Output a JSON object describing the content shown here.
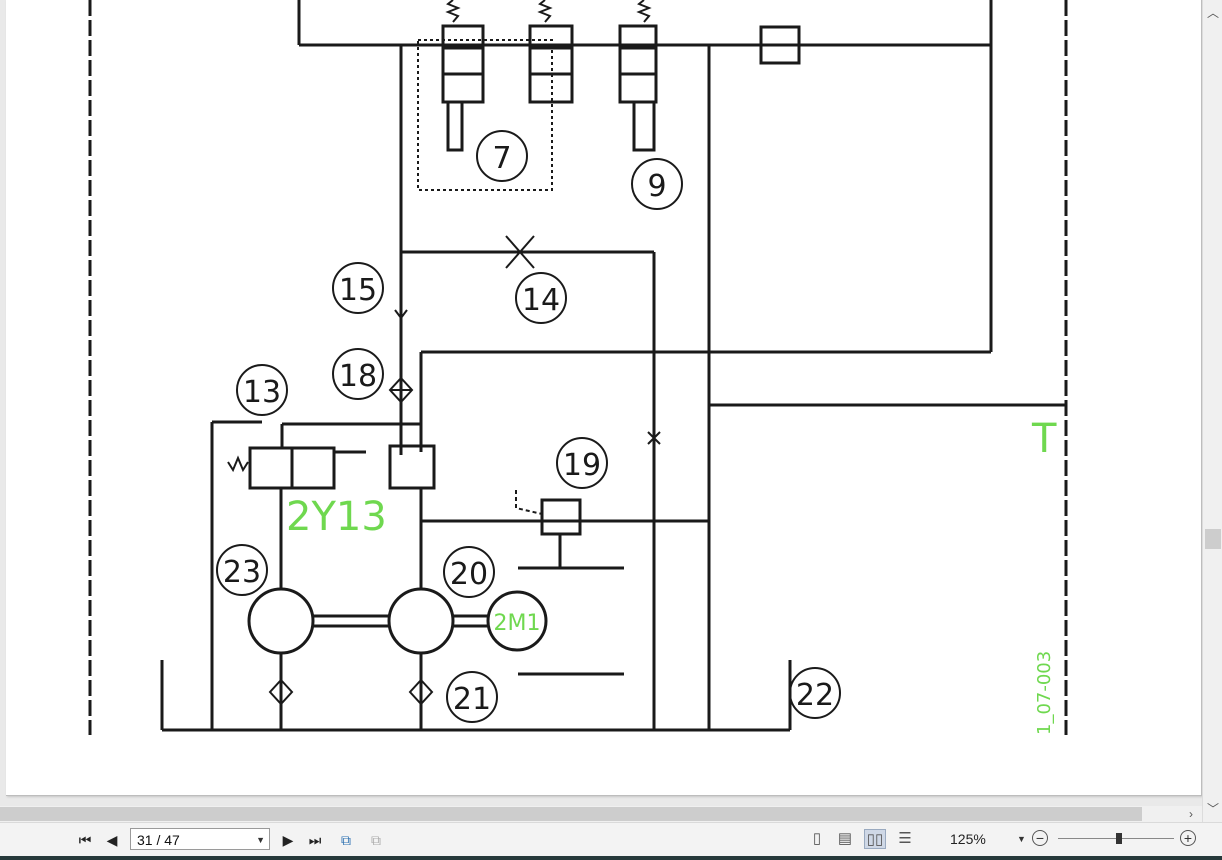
{
  "navigation": {
    "page_indicator": "31 / 47",
    "first_label": "first page",
    "prev_label": "previous page",
    "next_label": "next page",
    "last_label": "last page"
  },
  "zoom": {
    "value": "125%"
  },
  "colors": {
    "green_label": "#6fd84f",
    "line": "#1a1a1a"
  },
  "schematic": {
    "callouts": [
      "7",
      "9",
      "15",
      "14",
      "18",
      "13",
      "19",
      "23",
      "20",
      "21",
      "22"
    ],
    "valve_label": "2Y13",
    "motor_label": "2M1",
    "tank_label": "T",
    "drawing_id": "1_07-003"
  }
}
